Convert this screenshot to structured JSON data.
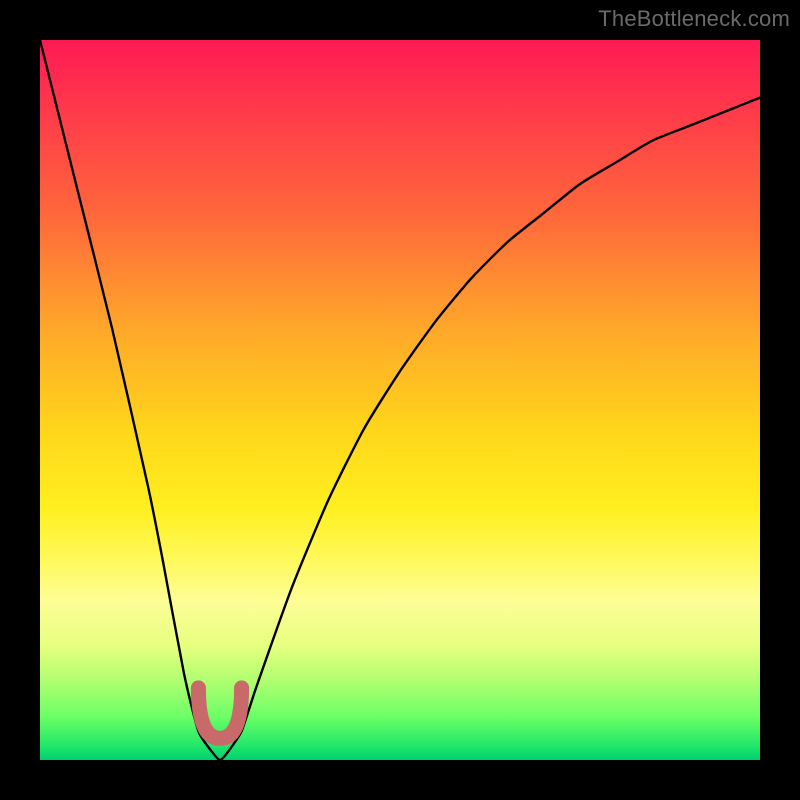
{
  "watermark": "TheBottleneck.com",
  "chart_data": {
    "type": "line",
    "title": "",
    "xlabel": "",
    "ylabel": "",
    "xlim": [
      0,
      100
    ],
    "ylim": [
      0,
      100
    ],
    "series": [
      {
        "name": "bottleneck-curve",
        "x": [
          0,
          5,
          10,
          15,
          17,
          20,
          22,
          24,
          25,
          26,
          28,
          30,
          35,
          40,
          45,
          50,
          55,
          60,
          65,
          70,
          75,
          80,
          85,
          90,
          95,
          100
        ],
        "values": [
          100,
          80,
          60,
          38,
          28,
          12,
          4,
          1,
          0,
          1,
          4,
          10,
          24,
          36,
          46,
          54,
          61,
          67,
          72,
          76,
          80,
          83,
          86,
          88,
          90,
          92
        ]
      }
    ],
    "valley_marker": {
      "x_range": [
        22,
        28
      ],
      "y": 3,
      "color": "#c86a6a"
    },
    "background_gradient": {
      "top": "#ff1a54",
      "mid": "#ffd81a",
      "bottom": "#00d070"
    }
  }
}
